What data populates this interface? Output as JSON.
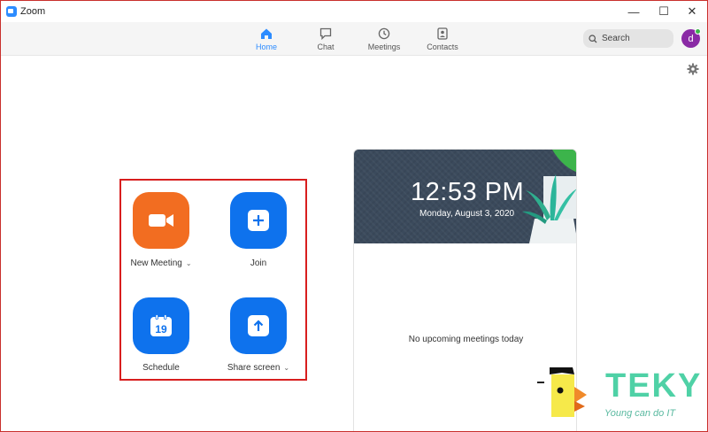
{
  "window": {
    "title": "Zoom",
    "controls": {
      "minimize": "—",
      "maximize": "☐",
      "close": "✕"
    }
  },
  "nav": {
    "tabs": [
      {
        "label": "Home",
        "icon": "home-icon",
        "active": true
      },
      {
        "label": "Chat",
        "icon": "chat-icon",
        "active": false
      },
      {
        "label": "Meetings",
        "icon": "clock-icon",
        "active": false
      },
      {
        "label": "Contacts",
        "icon": "contacts-icon",
        "active": false
      }
    ],
    "search": {
      "placeholder": "Search"
    },
    "avatar": {
      "initial": "d",
      "color": "#8a2aa5",
      "status_color": "#3cb44b"
    }
  },
  "actions": {
    "new_meeting": {
      "label": "New Meeting",
      "icon": "video-camera-icon",
      "color": "#f26d21"
    },
    "join": {
      "label": "Join",
      "icon": "plus-icon",
      "color": "#0e72ed"
    },
    "schedule": {
      "label": "Schedule",
      "icon": "calendar-icon",
      "calendar_day": "19",
      "color": "#0e72ed"
    },
    "share_screen": {
      "label": "Share screen",
      "icon": "upload-arrow-icon",
      "color": "#0e72ed"
    },
    "highlight_color": "#d81e1e"
  },
  "clock": {
    "time": "12:53 PM",
    "date": "Monday, August 3, 2020",
    "empty_message": "No upcoming meetings today"
  },
  "watermark": {
    "brand": "TEKY",
    "tagline": "Young can do IT",
    "color": "#4fd1a6"
  },
  "colors": {
    "accent": "#2d8cff",
    "tab_active": "#2d8cff"
  }
}
